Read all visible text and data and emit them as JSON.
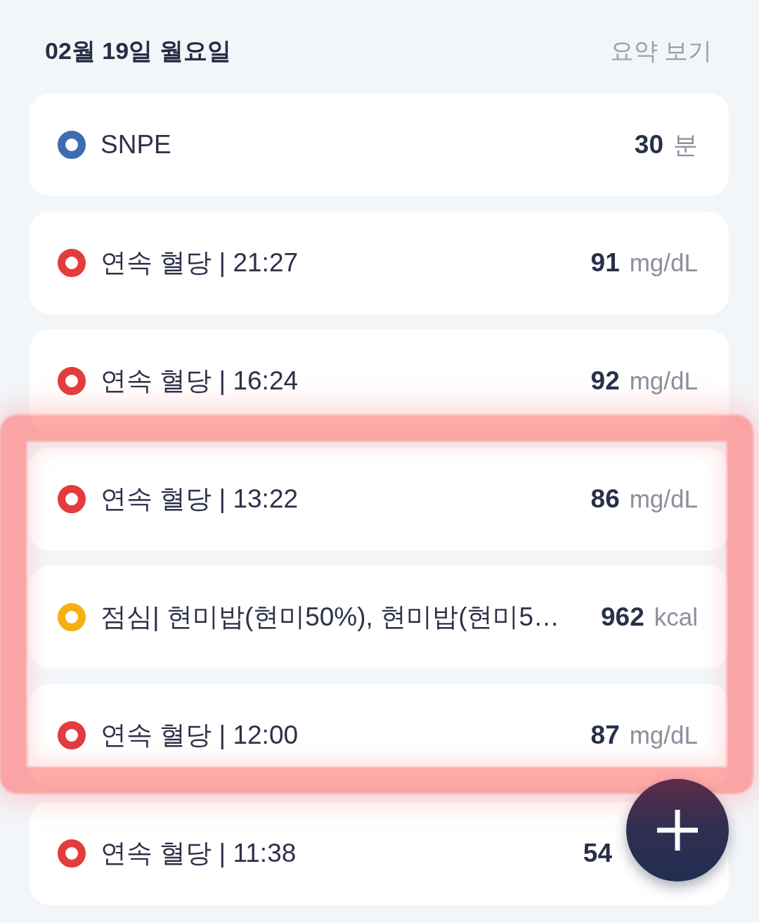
{
  "header": {
    "date": "02월 19일 월요일",
    "summary_link": "요약 보기"
  },
  "entries": [
    {
      "label": "SNPE",
      "value": "30",
      "unit": "분",
      "color": "#3d6db0",
      "highlighted": false
    },
    {
      "label": "연속 혈당 | 21:27",
      "value": "91",
      "unit": "mg/dL",
      "color": "#e23c3c",
      "highlighted": false
    },
    {
      "label": "연속 혈당 | 16:24",
      "value": "92",
      "unit": "mg/dL",
      "color": "#e23c3c",
      "highlighted": false
    },
    {
      "label": "연속 혈당 | 13:22",
      "value": "86",
      "unit": "mg/dL",
      "color": "#e23c3c",
      "highlighted": true
    },
    {
      "label": "점심| 현미밥(현미50%), 현미밥(현미5…",
      "value": "962",
      "unit": "kcal",
      "color": "#f6b012",
      "highlighted": true
    },
    {
      "label": "연속 혈당 | 12:00",
      "value": "87",
      "unit": "mg/dL",
      "color": "#e23c3c",
      "highlighted": true
    },
    {
      "label": "연속 혈당 | 11:38",
      "value": "54",
      "color": "#e23c3c",
      "highlighted": false
    }
  ]
}
